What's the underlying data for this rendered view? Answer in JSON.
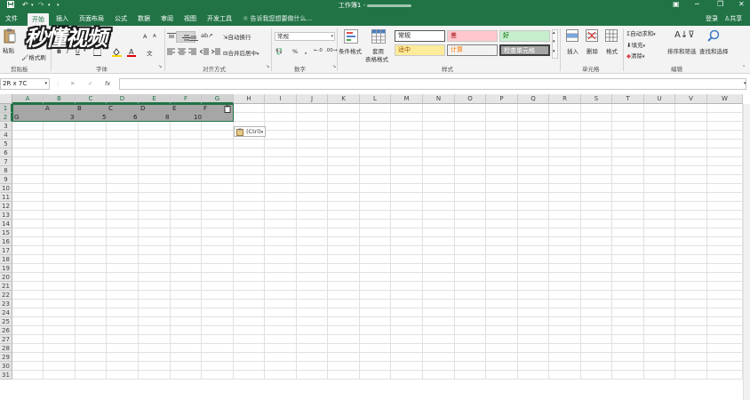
{
  "titlebar": {
    "title": "工作簿1 -",
    "qa_icons": [
      "save-icon",
      "undo-icon",
      "redo-icon",
      "customize-icon"
    ],
    "window_controls": [
      "ribbon-display-icon",
      "minimize-icon",
      "restore-icon",
      "close-icon"
    ]
  },
  "tabs": [
    {
      "label": "文件"
    },
    {
      "label": "开始"
    },
    {
      "label": "插入"
    },
    {
      "label": "页面布局"
    },
    {
      "label": "公式"
    },
    {
      "label": "数据"
    },
    {
      "label": "审阅"
    },
    {
      "label": "视图"
    },
    {
      "label": "开发工具"
    }
  ],
  "active_tab": "开始",
  "tell_me": "告诉我您想要做什么...",
  "account": {
    "login": "登录",
    "share": "共享"
  },
  "ribbon": {
    "clipboard": {
      "paste": "粘贴",
      "format_painter": "格式刷",
      "label": "剪贴板"
    },
    "font": {
      "label": "字体",
      "bold": "B",
      "italic": "I",
      "underline": "U",
      "grow": "A",
      "shrink": "A"
    },
    "alignment": {
      "wrap": "自动换行",
      "merge": "合并后居中",
      "label": "对齐方式"
    },
    "number": {
      "format": "常规",
      "percent": "%",
      "comma": ",",
      "label": "数字"
    },
    "styles": {
      "conditional": "条件格式",
      "table_format_1": "套用",
      "table_format_2": "表格格式",
      "normal": "常规",
      "bad": "差",
      "good": "好",
      "neutral": "适中",
      "calc": "计算",
      "check": "检查单元格",
      "label": "样式"
    },
    "cells": {
      "insert": "插入",
      "delete": "删除",
      "format": "格式",
      "label": "单元格"
    },
    "editing": {
      "autosum": "自动求和",
      "fill": "填充",
      "clear": "清除",
      "sort": "排序和筛选",
      "find": "查找和选择",
      "label": "编辑"
    }
  },
  "watermark": "秒懂视频",
  "formula_bar": {
    "name_box": "2R x 7C",
    "fx": "fx",
    "cancel": "✕",
    "enter": "✓"
  },
  "columns": [
    "A",
    "B",
    "C",
    "D",
    "E",
    "F",
    "G",
    "H",
    "I",
    "J",
    "K",
    "L",
    "M",
    "N",
    "O",
    "P",
    "Q",
    "R",
    "S",
    "T",
    "U",
    "V",
    "W"
  ],
  "rows": [
    "1",
    "2",
    "3",
    "4",
    "5",
    "6",
    "7",
    "8",
    "9",
    "10",
    "11",
    "12",
    "13",
    "14",
    "15",
    "16",
    "17",
    "18",
    "19",
    "20",
    "21",
    "22",
    "23",
    "24",
    "25",
    "26",
    "27",
    "28",
    "29",
    "30",
    "31"
  ],
  "cells": {
    "r1": [
      "A",
      "B",
      "C",
      "D",
      "E",
      "F"
    ],
    "r2_text": "G",
    "r2_values": [
      "3",
      "5",
      "6",
      "8",
      "10"
    ]
  },
  "paste_options": "(Ctrl)",
  "colors": {
    "excel_green": "#217346",
    "selection": "#a6a6a6"
  }
}
